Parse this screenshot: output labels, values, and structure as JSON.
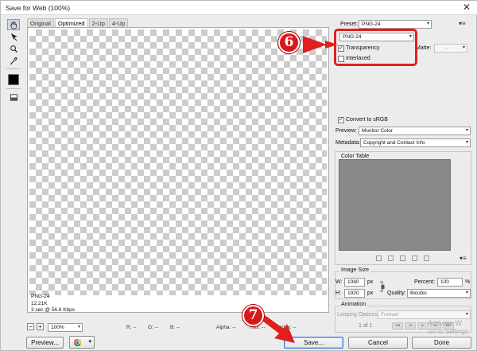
{
  "window": {
    "title": "Save for Web (100%)",
    "close_glyph": "✕"
  },
  "tabs": [
    "Original",
    "Optimized",
    "2-Up",
    "4-Up"
  ],
  "active_tab": "Optimized",
  "preview_info": {
    "format": "PNG-24",
    "size": "12.21K",
    "time": "3 sec @ 56.6 Kbps"
  },
  "status": {
    "zoom_minus": "−",
    "zoom_plus": "+",
    "zoom": "100%",
    "r": "R: --",
    "g": "G: --",
    "b": "B: --",
    "alpha": "Alpha: --",
    "hex": "Hex: --",
    "index": "Index: --"
  },
  "settings": {
    "preset_label": "Preset:",
    "preset_value": "PNG-24",
    "format_value": "PNG-24",
    "transparency_label": "Transparency",
    "transparency_checked": true,
    "interlaced_label": "Interlaced",
    "interlaced_checked": false,
    "matte_label": "Matte:",
    "matte_value": "--",
    "convert_srgb_label": "Convert to sRGB",
    "convert_srgb_checked": true,
    "preview_label": "Preview:",
    "preview_value": "Monitor Color",
    "metadata_label": "Metadata:",
    "metadata_value": "Copyright and Contact Info",
    "color_table_label": "Color Table"
  },
  "image_size": {
    "label": "Image Size",
    "w_label": "W:",
    "w_value": "1080",
    "w_unit": "px",
    "h_label": "H:",
    "h_value": "1920",
    "h_unit": "px",
    "percent_label": "Percent:",
    "percent_value": "100",
    "percent_unit": "%",
    "quality_label": "Quality:",
    "quality_value": "Bicubic"
  },
  "animation": {
    "label": "Animation",
    "looping_label": "Looping Options:",
    "looping_value": "Forever",
    "frame_counter": "1 of 1"
  },
  "buttons": {
    "preview": "Preview...",
    "save": "Save...",
    "cancel": "Cancel",
    "done": "Done"
  },
  "callouts": {
    "six": "6",
    "seven": "7"
  },
  "watermark": {
    "line1": "Activate W",
    "line2": "Go to Settings"
  },
  "colors": {
    "accent_red": "#d8181b",
    "primary_blue": "#3d7bd9"
  }
}
